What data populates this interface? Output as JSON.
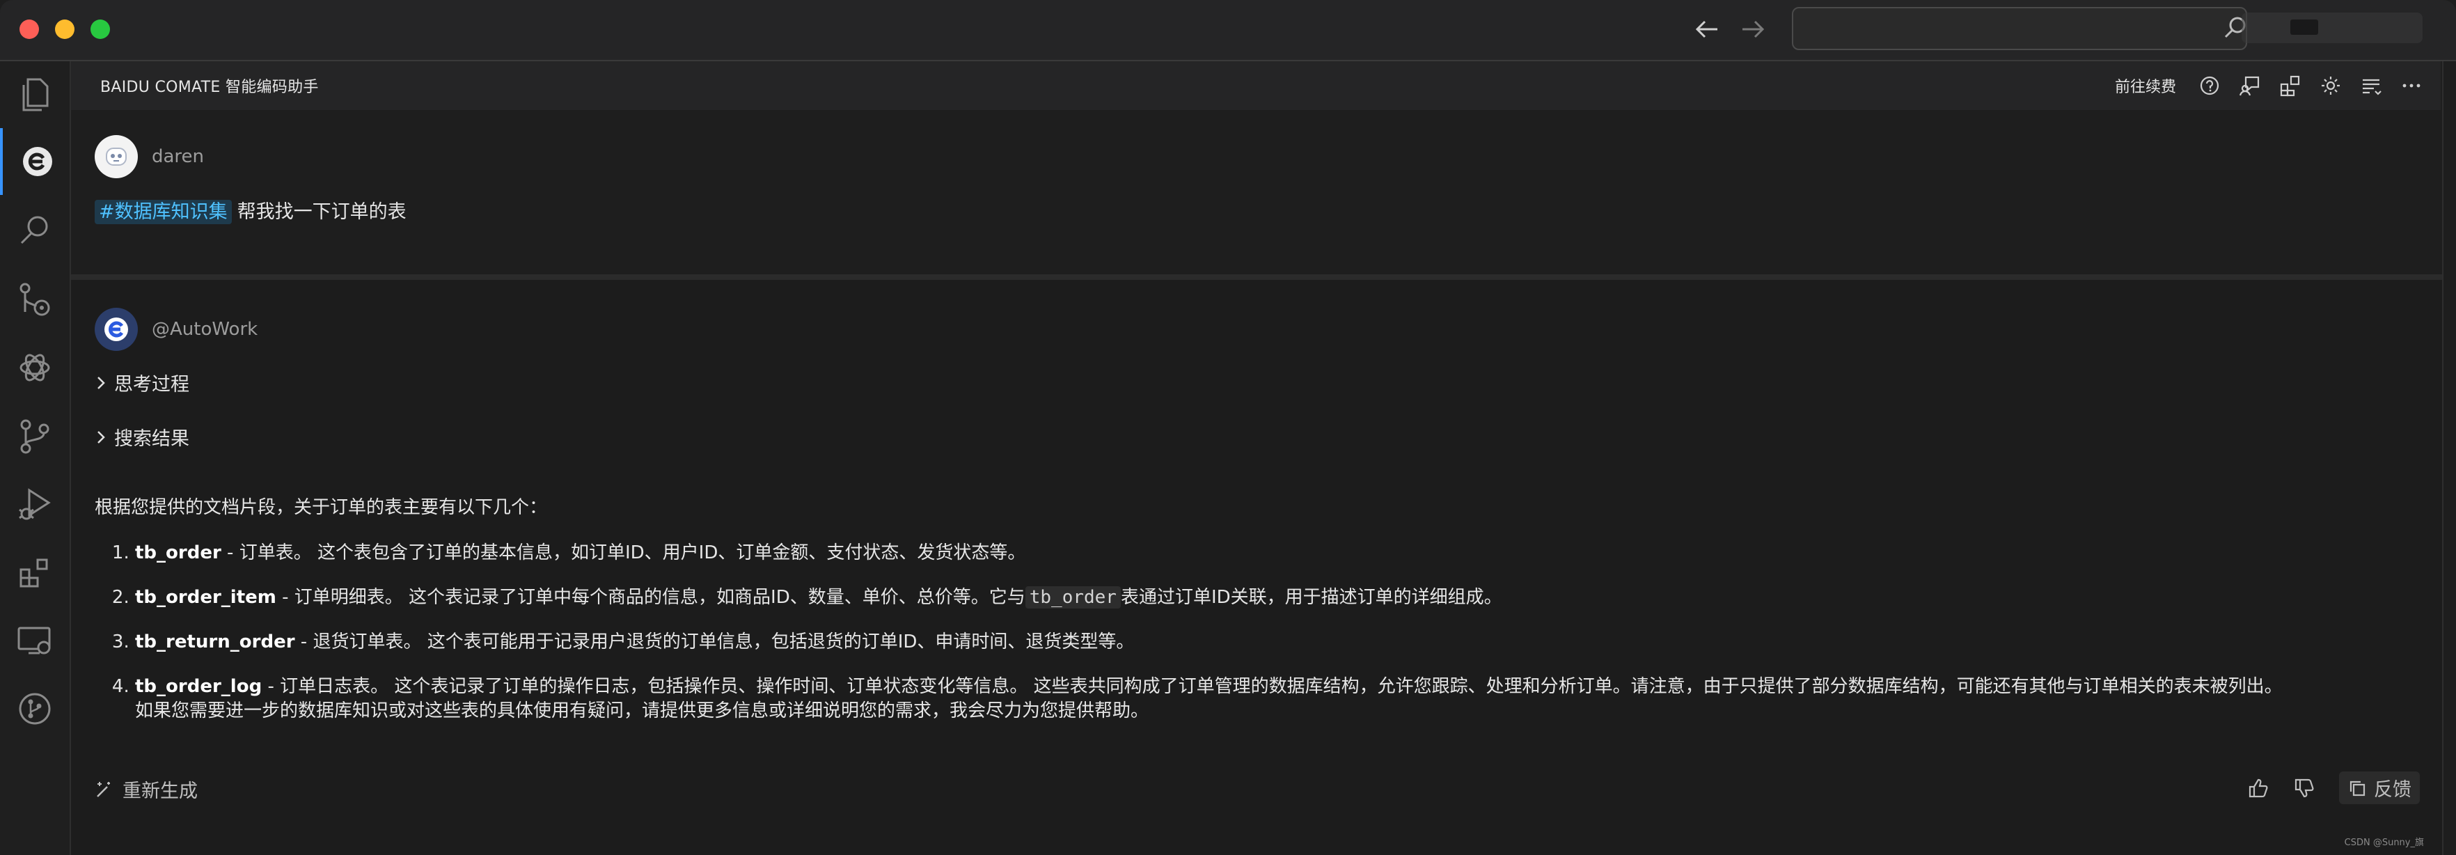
{
  "window": {
    "search_placeholder": "",
    "colors": {
      "close": "#fe5f57",
      "minimize": "#febc2e",
      "zoom": "#28c840"
    }
  },
  "activity_bar": {
    "items": [
      {
        "icon": "files-icon"
      },
      {
        "icon": "comate-icon",
        "active": true
      },
      {
        "icon": "search-icon"
      },
      {
        "icon": "source-control-settings-icon"
      },
      {
        "icon": "openai-icon"
      },
      {
        "icon": "git-branch-icon"
      },
      {
        "icon": "run-debug-icon"
      },
      {
        "icon": "extensions-icon"
      },
      {
        "icon": "remote-explorer-icon"
      },
      {
        "icon": "git-graph-icon"
      }
    ]
  },
  "panel": {
    "title": "BAIDU COMATE 智能编码助手",
    "renew_label": "前往续费",
    "actions": [
      "help-icon",
      "chat-feedback-icon",
      "plugins-icon",
      "settings-icon",
      "list-icon",
      "more-icon"
    ]
  },
  "user_message": {
    "username": "daren",
    "tag": "#数据库知识集",
    "text": "帮我找一下订单的表"
  },
  "bot_message": {
    "name": "@AutoWork",
    "thinking_label": "思考过程",
    "search_label": "搜索结果",
    "intro": "根据您提供的文档片段，关于订单的表主要有以下几个：",
    "items": [
      {
        "name": "tb_order",
        "desc": " - 订单表。 这个表包含了订单的基本信息，如订单ID、用户ID、订单金额、支付状态、发货状态等。"
      },
      {
        "name": "tb_order_item",
        "desc": " - 订单明细表。 这个表记录了订单中每个商品的信息，如商品ID、数量、单价、总价等。它与",
        "code": "tb_order",
        "desc2": "表通过订单ID关联，用于描述订单的详细组成。"
      },
      {
        "name": "tb_return_order",
        "desc": " - 退货订单表。 这个表可能用于记录用户退货的订单信息，包括退货的订单ID、申请时间、退货类型等。"
      },
      {
        "name": "tb_order_log",
        "desc": " - 订单日志表。 这个表记录了订单的操作日志，包括操作员、操作时间、订单状态变化等信息。 这些表共同构成了订单管理的数据库结构，允许您跟踪、处理和分析订单。请注意，由于只提供了部分数据库结构，可能还有其他与订单相关的表未被列出。",
        "desc_line2": "如果您需要进一步的数据库知识或对这些表的具体使用有疑问，请提供更多信息或详细说明您的需求，我会尽力为您提供帮助。"
      }
    ],
    "regenerate_label": "重新生成",
    "feedback_label": "反馈"
  },
  "watermark": "CSDN @Sunny_旗"
}
